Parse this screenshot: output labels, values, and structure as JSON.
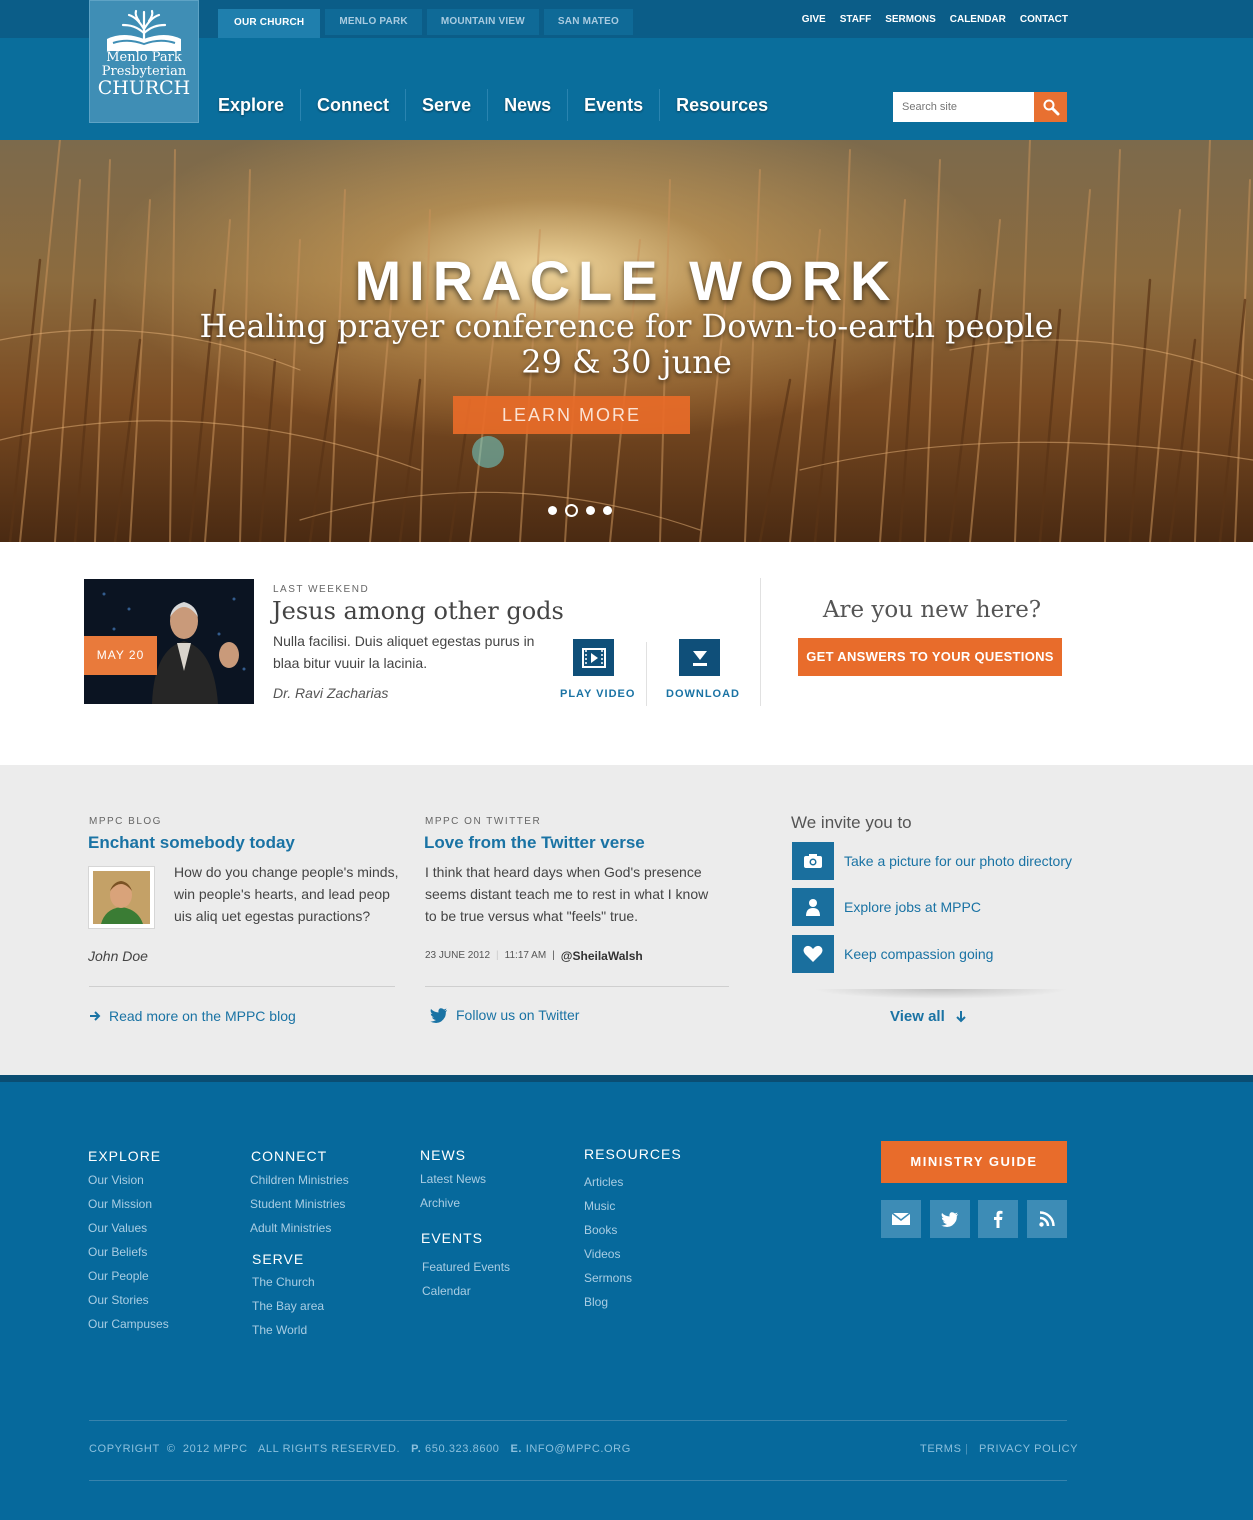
{
  "logo": {
    "line1": "Menlo Park",
    "line2": "Presbyterian",
    "line3": "Church"
  },
  "campus_tabs": [
    "OUR CHURCH",
    "MENLO PARK",
    "MOUNTAIN VIEW",
    "SAN MATEO"
  ],
  "util_nav": [
    "GIVE",
    "STAFF",
    "SERMONS",
    "CALENDAR",
    "CONTACT"
  ],
  "main_nav": [
    "Explore",
    "Connect",
    "Serve",
    "News",
    "Events",
    "Resources"
  ],
  "search": {
    "placeholder": "Search site"
  },
  "hero": {
    "title": "MIRACLE WORK",
    "subtitle_line1": "Healing prayer conference for Down-to-earth people",
    "subtitle_line2": "29 & 30 june",
    "button": "LEARN MORE",
    "slides": 4,
    "active_slide": 2
  },
  "sermon": {
    "date": "MAY 20",
    "kicker": "LAST WEEKEND",
    "title": "Jesus among other gods",
    "desc": "Nulla facilisi. Duis aliquet egestas purus in blaa bitur vuuir la lacinia.",
    "author": "Dr. Ravi Zacharias",
    "play_label": "PLAY VIDEO",
    "download_label": "DOWNLOAD"
  },
  "newcomer": {
    "question": "Are you new here?",
    "button": "GET ANSWERS TO YOUR QUESTIONS"
  },
  "blog": {
    "kicker": "MPPC BLOG",
    "title": "Enchant somebody today",
    "text": "How do you change people's minds, win people's hearts, and lead peop uis aliq uet egestas puractions?",
    "author": "John Doe",
    "link": "Read more on the MPPC blog"
  },
  "twitter": {
    "kicker": "MPPC ON TWITTER",
    "title": "Love from the Twitter verse",
    "text": "I think that heard days when God's presence seems distant teach me to rest in what I know to be true versus what \"feels\" true.",
    "date": "23 JUNE 2012",
    "time": "11:17 AM",
    "handle": "@SheilaWalsh",
    "link": "Follow us on Twitter"
  },
  "invite": {
    "heading": "We invite you to",
    "items": [
      {
        "icon": "camera-icon",
        "label": "Take a picture for our photo directory"
      },
      {
        "icon": "person-icon",
        "label": "Explore jobs at MPPC"
      },
      {
        "icon": "heart-icon",
        "label": "Keep compassion going"
      }
    ],
    "view_all": "View all"
  },
  "footer": {
    "explore": {
      "heading": "EXPLORE",
      "links": [
        "Our Vision",
        "Our Mission",
        "Our Values",
        "Our Beliefs",
        "Our People",
        "Our Stories",
        "Our Campuses"
      ]
    },
    "connect": {
      "heading": "CONNECT",
      "links": [
        "Children Ministries",
        "Student Ministries",
        "Adult Ministries"
      ]
    },
    "serve": {
      "heading": "SERVE",
      "links": [
        "The Church",
        "The Bay area",
        "The World"
      ]
    },
    "news": {
      "heading": "NEWS",
      "links": [
        "Latest News",
        "Archive"
      ]
    },
    "events": {
      "heading": "EVENTS",
      "links": [
        "Featured Events",
        "Calendar"
      ]
    },
    "resources": {
      "heading": "RESOURCES",
      "links": [
        "Articles",
        "Music",
        "Books",
        "Videos",
        "Sermons",
        "Blog"
      ]
    },
    "ministry_button": "MINISTRY GUIDE",
    "social": [
      "mail-icon",
      "twitter-icon",
      "facebook-icon",
      "rss-icon"
    ],
    "copyright": "COPYRIGHT  ©  2012 MPPC   ALL RIGHTS RESERVED.",
    "phone_label": "P.",
    "phone": "650.323.8600",
    "email_label": "E.",
    "email": "INFO@MPPC.ORG",
    "terms": "TERMS",
    "privacy": "PRIVACY POLICY"
  },
  "colors": {
    "brand_blue": "#0a6e9c",
    "accent_orange": "#e86c2b",
    "link_blue": "#1a73a4"
  }
}
